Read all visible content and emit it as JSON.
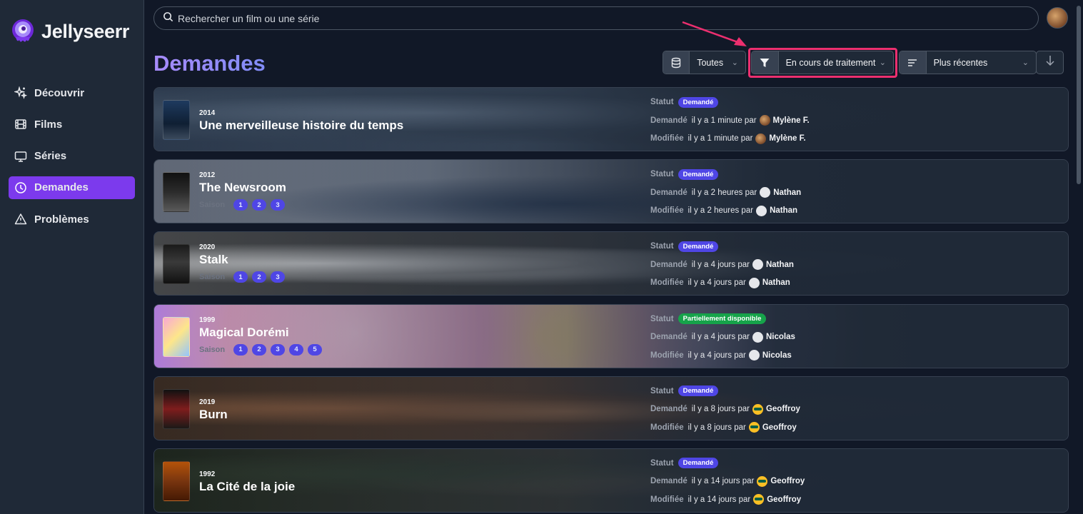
{
  "app": {
    "name": "Jellyseerr"
  },
  "sidebar": {
    "items": [
      {
        "label": "Découvrir",
        "icon": "sparkles-icon",
        "active": false
      },
      {
        "label": "Films",
        "icon": "film-icon",
        "active": false
      },
      {
        "label": "Séries",
        "icon": "tv-icon",
        "active": false
      },
      {
        "label": "Demandes",
        "icon": "clock-icon",
        "active": true
      },
      {
        "label": "Problèmes",
        "icon": "warning-icon",
        "active": false
      }
    ]
  },
  "search": {
    "placeholder": "Rechercher un film ou une série"
  },
  "page": {
    "title": "Demandes"
  },
  "filters": {
    "media_type": "Toutes",
    "status": "En cours de traitement",
    "sort": "Plus récentes"
  },
  "labels": {
    "statut": "Statut",
    "demande": "Demandé",
    "modifiee": "Modifiée",
    "saison": "Saison",
    "par": "par"
  },
  "colors": {
    "accent": "#7c3aed",
    "requested": "#4f46e5",
    "partial": "#16a34a",
    "highlight": "#ec2f6f"
  },
  "requests": [
    {
      "year": "2014",
      "title": "Une merveilleuse histoire du temps",
      "seasons": [],
      "status": "Demandé",
      "requested": "il y a 1 minute par",
      "requested_by": "Mylène F.",
      "modified": "il y a 1 minute par",
      "modified_by": "Mylène F."
    },
    {
      "year": "2012",
      "title": "The Newsroom",
      "seasons": [
        "1",
        "2",
        "3"
      ],
      "status": "Demandé",
      "requested": "il y a 2 heures par",
      "requested_by": "Nathan",
      "modified": "il y a 2 heures par",
      "modified_by": "Nathan"
    },
    {
      "year": "2020",
      "title": "Stalk",
      "seasons": [
        "1",
        "2",
        "3"
      ],
      "status": "Demandé",
      "requested": "il y a 4 jours par",
      "requested_by": "Nathan",
      "modified": "il y a 4 jours par",
      "modified_by": "Nathan"
    },
    {
      "year": "1999",
      "title": "Magical Dorémi",
      "seasons": [
        "1",
        "2",
        "3",
        "4",
        "5"
      ],
      "status": "Partiellement disponible",
      "requested": "il y a 4 jours par",
      "requested_by": "Nicolas",
      "modified": "il y a 4 jours par",
      "modified_by": "Nicolas"
    },
    {
      "year": "2019",
      "title": "Burn",
      "seasons": [],
      "status": "Demandé",
      "requested": "il y a 8 jours par",
      "requested_by": "Geoffroy",
      "modified": "il y a 8 jours par",
      "modified_by": "Geoffroy"
    },
    {
      "year": "1992",
      "title": "La Cité de la joie",
      "seasons": [],
      "status": "Demandé",
      "requested": "il y a 14 jours par",
      "requested_by": "Geoffroy",
      "modified": "il y a 14 jours par",
      "modified_by": "Geoffroy"
    }
  ]
}
